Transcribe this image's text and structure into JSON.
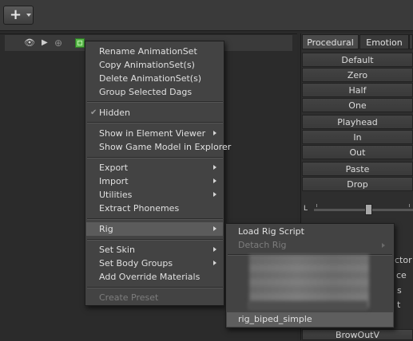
{
  "toolbar": {
    "add_icon": "plus-icon",
    "add_caret": "chevron-down-icon"
  },
  "tree": {
    "row_icons": [
      "eye-icon",
      "pointer-icon",
      "target-icon",
      "cube-icon"
    ]
  },
  "tabs": [
    {
      "label": "Procedural",
      "active": true
    },
    {
      "label": "Emotion",
      "active": false
    }
  ],
  "procedural_buttons": [
    "Default",
    "Zero",
    "Half",
    "One",
    "Playhead",
    "In",
    "Out",
    "Paste",
    "Drop"
  ],
  "slider": {
    "label": "L"
  },
  "context_menu": {
    "items": [
      {
        "label": "Rename AnimationSet"
      },
      {
        "label": "Copy AnimationSet(s)"
      },
      {
        "label": "Delete AnimationSet(s)"
      },
      {
        "label": "Group Selected Dags"
      },
      {
        "label": "Hidden",
        "checked": true
      },
      {
        "label": "Show in Element Viewer",
        "submenu": true
      },
      {
        "label": "Show Game Model in Explorer"
      },
      {
        "label": "Export",
        "submenu": true
      },
      {
        "label": "Import",
        "submenu": true
      },
      {
        "label": "Utilities",
        "submenu": true
      },
      {
        "label": "Extract Phonemes"
      },
      {
        "label": "Rig",
        "submenu": true,
        "active": true
      },
      {
        "label": "Set Skin",
        "submenu": true
      },
      {
        "label": "Set Body Groups",
        "submenu": true
      },
      {
        "label": "Add Override Materials"
      },
      {
        "label": "Create Preset",
        "disabled": true
      }
    ]
  },
  "rig_submenu": {
    "items": [
      {
        "label": "Load Rig Script"
      },
      {
        "label": "Detach Rig",
        "disabled": true,
        "submenu": true
      },
      {
        "label": "rig_biped_simple",
        "active": true
      }
    ]
  },
  "partial_labels": {
    "actor": "ctor",
    "ce": "ce",
    "s": "s",
    "t": "t",
    "browoutv": "BrowOutV"
  }
}
